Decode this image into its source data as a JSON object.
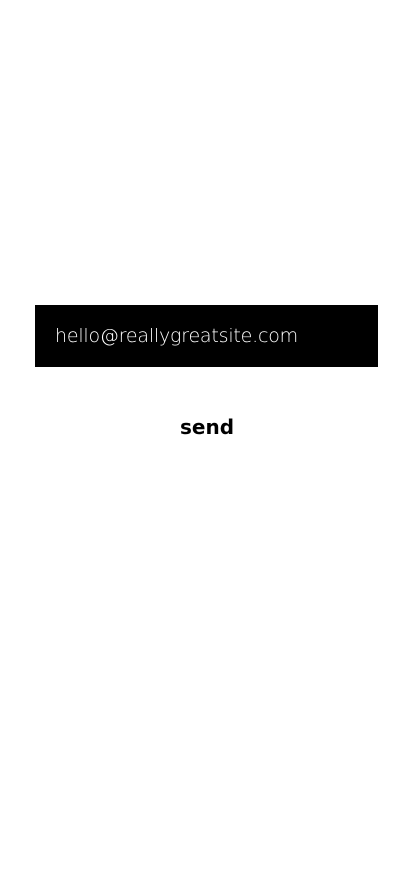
{
  "email_field": {
    "value": "hello@reallygreatsite.com",
    "background_color": "#000000",
    "text_color": "#ffffff"
  },
  "send_button": {
    "label": "send"
  }
}
